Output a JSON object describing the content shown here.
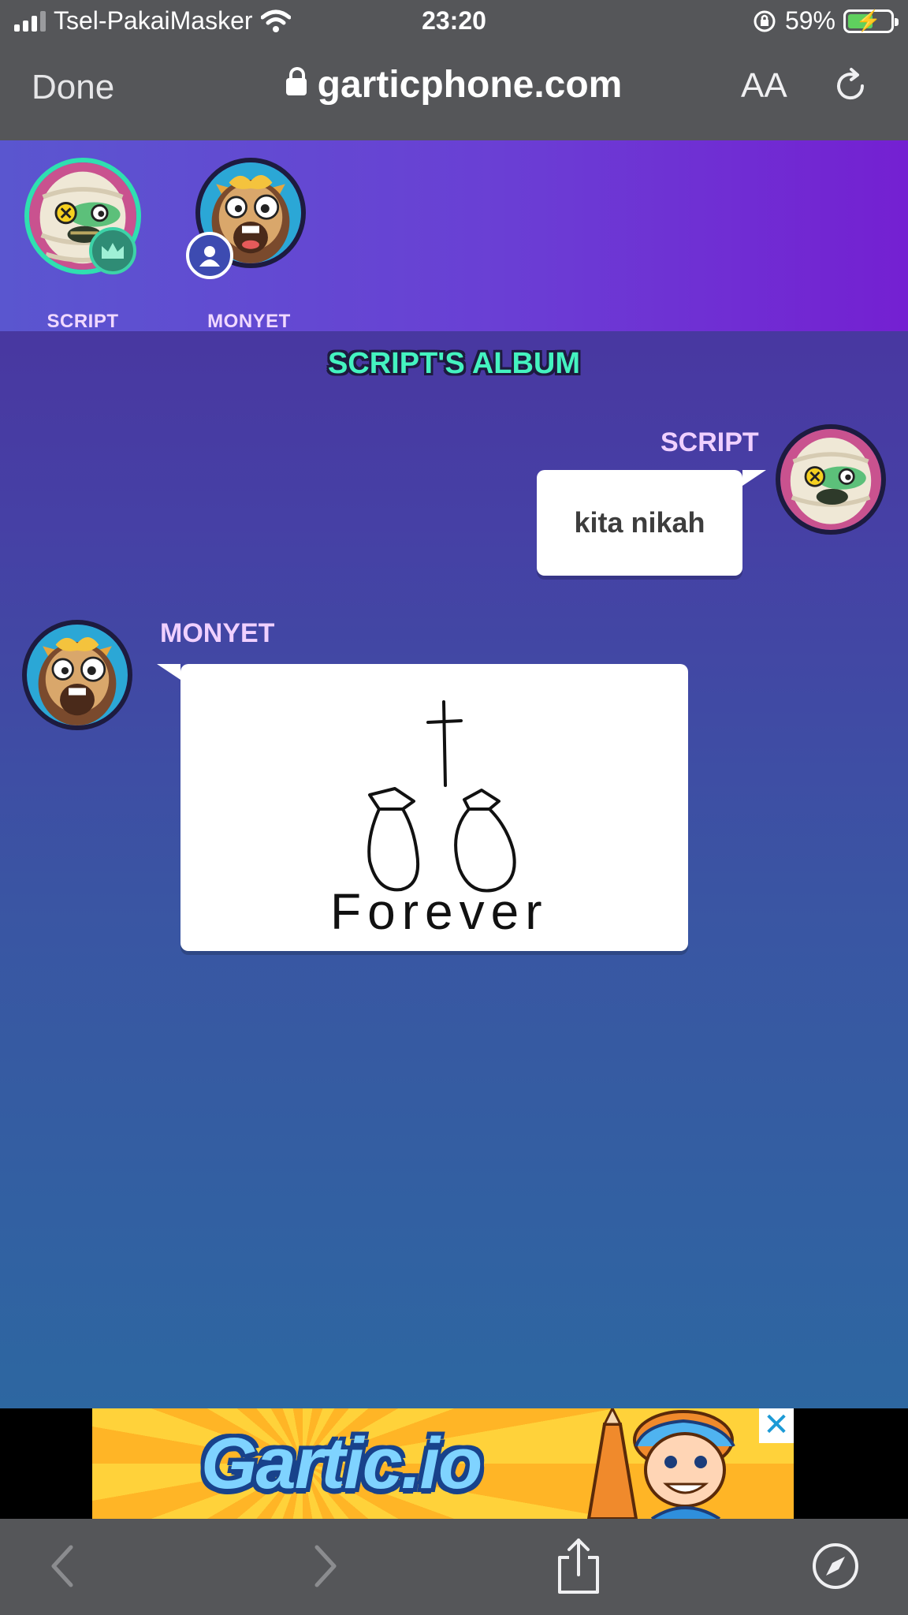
{
  "status_bar": {
    "carrier": "Tsel-PakaiMasker",
    "time": "23:20",
    "battery_percent": "59%",
    "battery_level": 0.59
  },
  "browser": {
    "done_label": "Done",
    "url": "garticphone.com",
    "text_size_label": "AA"
  },
  "players": [
    {
      "name": "SCRIPT",
      "badge": "crown-icon"
    },
    {
      "name": "MONYET",
      "badge": "user-icon"
    }
  ],
  "album": {
    "title": "SCRIPT'S ALBUM",
    "entries": [
      {
        "author": "SCRIPT",
        "type": "text",
        "text": "kita nikah"
      },
      {
        "author": "MONYET",
        "type": "drawing",
        "drawing_text": "Forever"
      }
    ]
  },
  "ad": {
    "brand": "Gartic.io",
    "close_label": "✕"
  },
  "colors": {
    "accent_teal": "#44f3c0",
    "player_name": "#f1d9ff",
    "chrome": "#555659"
  }
}
